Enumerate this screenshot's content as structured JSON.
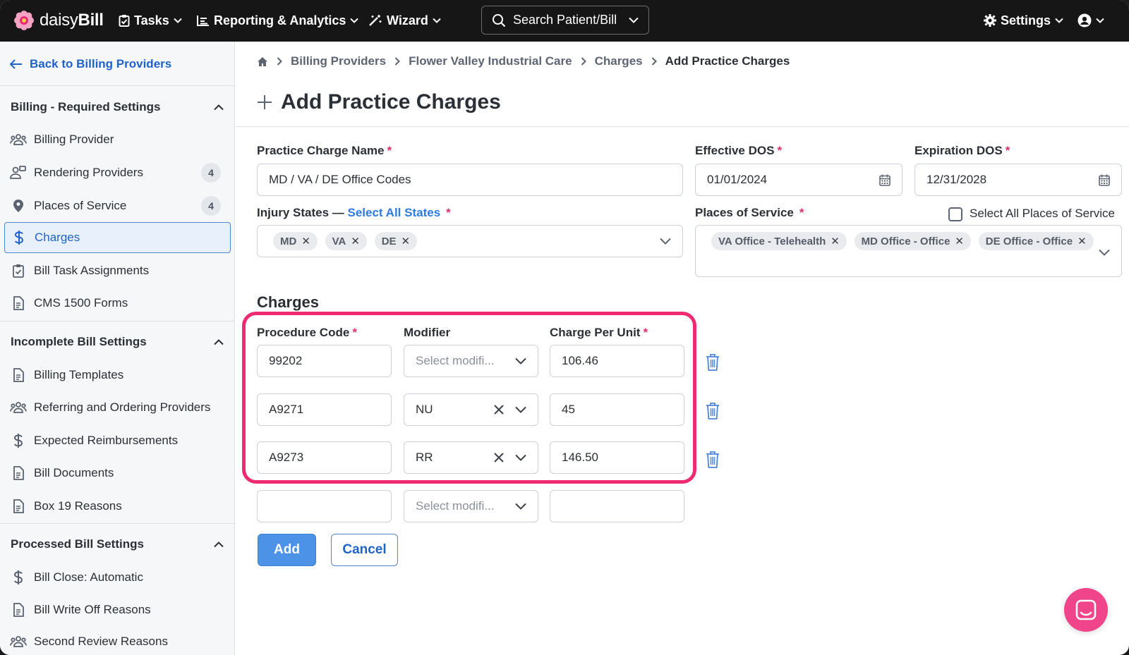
{
  "app": {
    "name_light": "daisy",
    "name_bold": "Bill"
  },
  "topnav": {
    "tasks": "Tasks",
    "reporting": "Reporting & Analytics",
    "wizard": "Wizard",
    "search_placeholder": "Search Patient/Bill",
    "settings": "Settings"
  },
  "sidebar": {
    "back_label": "Back to Billing Providers",
    "sections": [
      {
        "title": "Billing - Required Settings",
        "items": [
          {
            "label": "Billing Provider",
            "icon": "people-icon"
          },
          {
            "label": "Rendering Providers",
            "icon": "provider-icon",
            "badge": "4"
          },
          {
            "label": "Places of Service",
            "icon": "map-pin-icon",
            "badge": "4"
          },
          {
            "label": "Charges",
            "icon": "dollar-icon",
            "active": true
          },
          {
            "label": "Bill Task Assignments",
            "icon": "clipboard-icon"
          },
          {
            "label": "CMS 1500 Forms",
            "icon": "document-icon"
          }
        ]
      },
      {
        "title": "Incomplete Bill Settings",
        "items": [
          {
            "label": "Billing Templates",
            "icon": "document-icon"
          },
          {
            "label": "Referring and Ordering Providers",
            "icon": "people-icon"
          },
          {
            "label": "Expected Reimbursements",
            "icon": "dollar-icon"
          },
          {
            "label": "Bill Documents",
            "icon": "document-icon"
          },
          {
            "label": "Box 19 Reasons",
            "icon": "document-icon"
          }
        ]
      },
      {
        "title": "Processed Bill Settings",
        "items": [
          {
            "label": "Bill Close: Automatic",
            "icon": "dollar-icon"
          },
          {
            "label": "Bill Write Off Reasons",
            "icon": "document-icon"
          },
          {
            "label": "Second Review Reasons",
            "icon": "people-icon"
          }
        ]
      }
    ]
  },
  "breadcrumb": [
    "Billing Providers",
    "Flower Valley Industrial Care",
    "Charges",
    "Add Practice Charges"
  ],
  "page_title": "Add Practice Charges",
  "form": {
    "charge_name_label": "Practice Charge Name",
    "charge_name_value": "MD / VA / DE Office Codes",
    "effective_label": "Effective DOS",
    "effective_value": "01/01/2024",
    "expiration_label": "Expiration DOS",
    "expiration_value": "12/31/2028",
    "injury_label": "Injury States —",
    "injury_select_all": "Select All States",
    "injury_states": [
      "MD",
      "VA",
      "DE"
    ],
    "places_label": "Places of Service",
    "places_select_all": "Select All Places of Service",
    "places": [
      "VA Office - Telehealth",
      "MD Office - Office",
      "DE Office - Office"
    ],
    "required_mark": "*"
  },
  "charges": {
    "section_title": "Charges",
    "col_code": "Procedure Code",
    "col_modifier": "Modifier",
    "col_charge": "Charge Per Unit",
    "modifier_placeholder": "Select modifi...",
    "rows": [
      {
        "code": "99202",
        "modifier": "",
        "charge": "106.46"
      },
      {
        "code": "A9271",
        "modifier": "NU",
        "charge": "45"
      },
      {
        "code": "A9273",
        "modifier": "RR",
        "charge": "146.50"
      },
      {
        "code": "",
        "modifier": "",
        "charge": ""
      }
    ]
  },
  "buttons": {
    "add": "Add",
    "cancel": "Cancel"
  },
  "colors": {
    "accent": "#1f63c9",
    "highlight": "#ee2a73",
    "topbar": "#161616",
    "primary_button": "#4c92e6"
  }
}
